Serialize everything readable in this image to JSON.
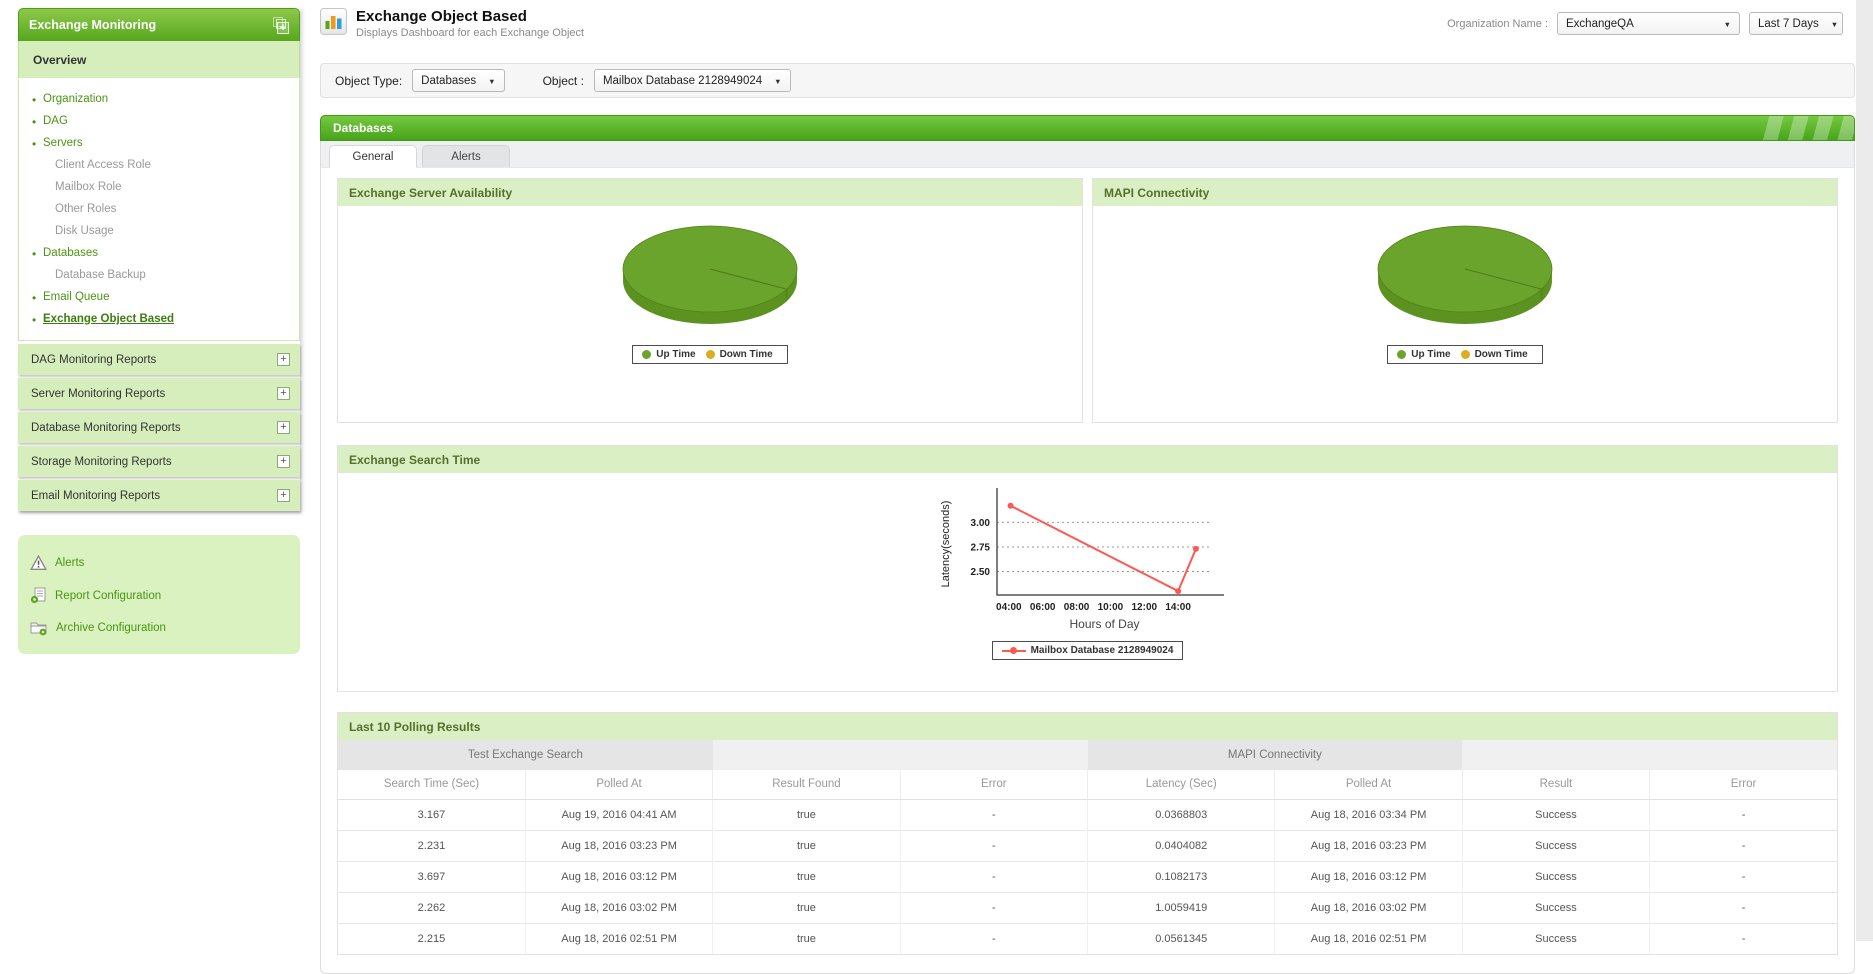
{
  "colors": {
    "up_time": "#6aa42c",
    "up_time_dark": "#5c9220",
    "down_time": "#d9af1e",
    "series_line": "#ff5752",
    "panel_header_green": "#dbefc5",
    "sidebar_green": "#57a71e"
  },
  "sidebar": {
    "title": "Exchange Monitoring",
    "overview_title": "Overview",
    "nav_items": [
      {
        "label": "Organization",
        "type": "primary"
      },
      {
        "label": "DAG",
        "type": "primary"
      },
      {
        "label": "Servers",
        "type": "primary"
      },
      {
        "label": "Client Access Role",
        "type": "sub"
      },
      {
        "label": "Mailbox Role",
        "type": "sub"
      },
      {
        "label": "Other Roles",
        "type": "sub"
      },
      {
        "label": "Disk Usage",
        "type": "sub"
      },
      {
        "label": "Databases",
        "type": "primary"
      },
      {
        "label": "Database Backup",
        "type": "sub"
      },
      {
        "label": "Email Queue",
        "type": "primary"
      },
      {
        "label": "Exchange Object Based",
        "type": "primary",
        "active": true
      }
    ],
    "report_sections": [
      "DAG Monitoring Reports",
      "Server Monitoring Reports",
      "Database Monitoring Reports",
      "Storage Monitoring Reports",
      "Email Monitoring Reports"
    ],
    "tools": [
      {
        "label": "Alerts",
        "icon": "alert-triangle-icon"
      },
      {
        "label": "Report Configuration",
        "icon": "report-config-icon"
      },
      {
        "label": "Archive Configuration",
        "icon": "archive-config-icon"
      }
    ]
  },
  "header": {
    "title": "Exchange Object Based",
    "subtitle": "Displays Dashboard for each Exchange Object",
    "organization_label": "Organization Name :",
    "organization_value": "ExchangeQA",
    "time_range_value": "Last 7 Days"
  },
  "filters": {
    "object_type_label": "Object Type:",
    "object_type_value": "Databases",
    "object_label": "Object :",
    "object_value": "Mailbox Database 2128949024"
  },
  "section": {
    "title": "Databases",
    "tabs": [
      {
        "label": "General",
        "active": true
      },
      {
        "label": "Alerts",
        "active": false
      }
    ]
  },
  "main": {
    "availability_panel": {
      "title": "Exchange Server Availability",
      "legend": {
        "up": "Up Time",
        "down": "Down Time"
      },
      "chart_data": {
        "type": "pie",
        "labels": [
          "Up Time",
          "Down Time"
        ],
        "values": [
          100,
          0
        ],
        "colors": [
          "#6aa42c",
          "#d9af1e"
        ]
      }
    },
    "mapi_panel": {
      "title": "MAPI Connectivity",
      "legend": {
        "up": "Up Time",
        "down": "Down Time"
      },
      "chart_data": {
        "type": "pie",
        "labels": [
          "Up Time",
          "Down Time"
        ],
        "values": [
          100,
          0
        ],
        "colors": [
          "#6aa42c",
          "#d9af1e"
        ]
      }
    },
    "search_time_panel": {
      "title": "Exchange Search Time",
      "chart_data": {
        "type": "line",
        "xlabel": "Hours of Day",
        "ylabel": "Latency(seconds)",
        "x_ticks": [
          "04:00",
          "06:00",
          "08:00",
          "10:00",
          "12:00",
          "14:00"
        ],
        "y_ticks": [
          2.5,
          2.75,
          3.0
        ],
        "x_range": [
          3.3,
          16.0
        ],
        "y_range": [
          2.26,
          3.3
        ],
        "grid": "dotted-horizontal",
        "legend_position": "bottom",
        "series": [
          {
            "name": "Mailbox Database 2128949024",
            "color": "#ff5752",
            "points": [
              [
                4.1,
                3.17
              ],
              [
                14.0,
                2.3
              ],
              [
                15.05,
                2.73
              ]
            ]
          }
        ]
      }
    },
    "polling_panel": {
      "title": "Last 10 Polling Results",
      "group_headers": [
        "Test Exchange Search",
        "MAPI Connectivity"
      ],
      "columns": [
        "Search Time (Sec)",
        "Polled At",
        "Result Found",
        "Error",
        "Latency (Sec)",
        "Polled At",
        "Result",
        "Error"
      ],
      "rows": [
        [
          "3.167",
          "Aug 19, 2016 04:41 AM",
          "true",
          "-",
          "0.0368803",
          "Aug 18, 2016 03:34 PM",
          "Success",
          "-"
        ],
        [
          "2.231",
          "Aug 18, 2016 03:23 PM",
          "true",
          "-",
          "0.0404082",
          "Aug 18, 2016 03:23 PM",
          "Success",
          "-"
        ],
        [
          "3.697",
          "Aug 18, 2016 03:12 PM",
          "true",
          "-",
          "0.1082173",
          "Aug 18, 2016 03:12 PM",
          "Success",
          "-"
        ],
        [
          "2.262",
          "Aug 18, 2016 03:02 PM",
          "true",
          "-",
          "1.0059419",
          "Aug 18, 2016 03:02 PM",
          "Success",
          "-"
        ],
        [
          "2.215",
          "Aug 18, 2016 02:51 PM",
          "true",
          "-",
          "0.0561345",
          "Aug 18, 2016 02:51 PM",
          "Success",
          "-"
        ]
      ]
    }
  }
}
